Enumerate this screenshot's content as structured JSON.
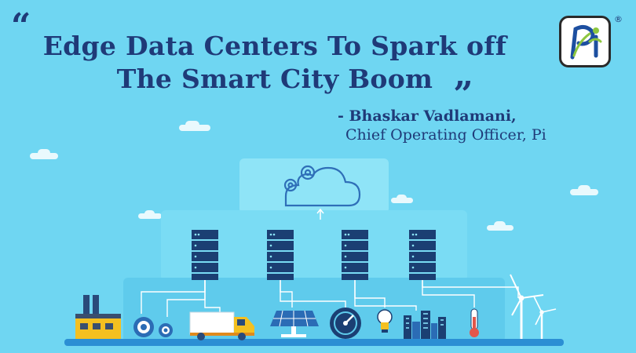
{
  "headline": {
    "open_quote": "“",
    "line1": "Edge Data Centers To Spark off",
    "line2": "The Smart City Boom",
    "close_quote": "„"
  },
  "attribution": {
    "name": "- Bhaskar Vadlamani,",
    "role": "Chief Operating Officer, Pi"
  },
  "logo": {
    "registered_mark": "®"
  },
  "colors": {
    "background": "#6fd6f2",
    "text": "#1f3a78",
    "tier_top": "#8fe4f7",
    "tier_mid": "#7adcf4",
    "tier_low": "#5fcbec",
    "logo_green": "#8dc63f",
    "logo_blue": "#1d4fa0"
  },
  "icons": [
    "factory-icon",
    "gears-icon",
    "truck-icon",
    "solar-panel-icon",
    "speedometer-icon",
    "light-bulb-icon",
    "city-buildings-icon",
    "thermometer-icon",
    "wind-turbine-icon",
    "cloud-gear-icon",
    "server-rack-icon"
  ]
}
